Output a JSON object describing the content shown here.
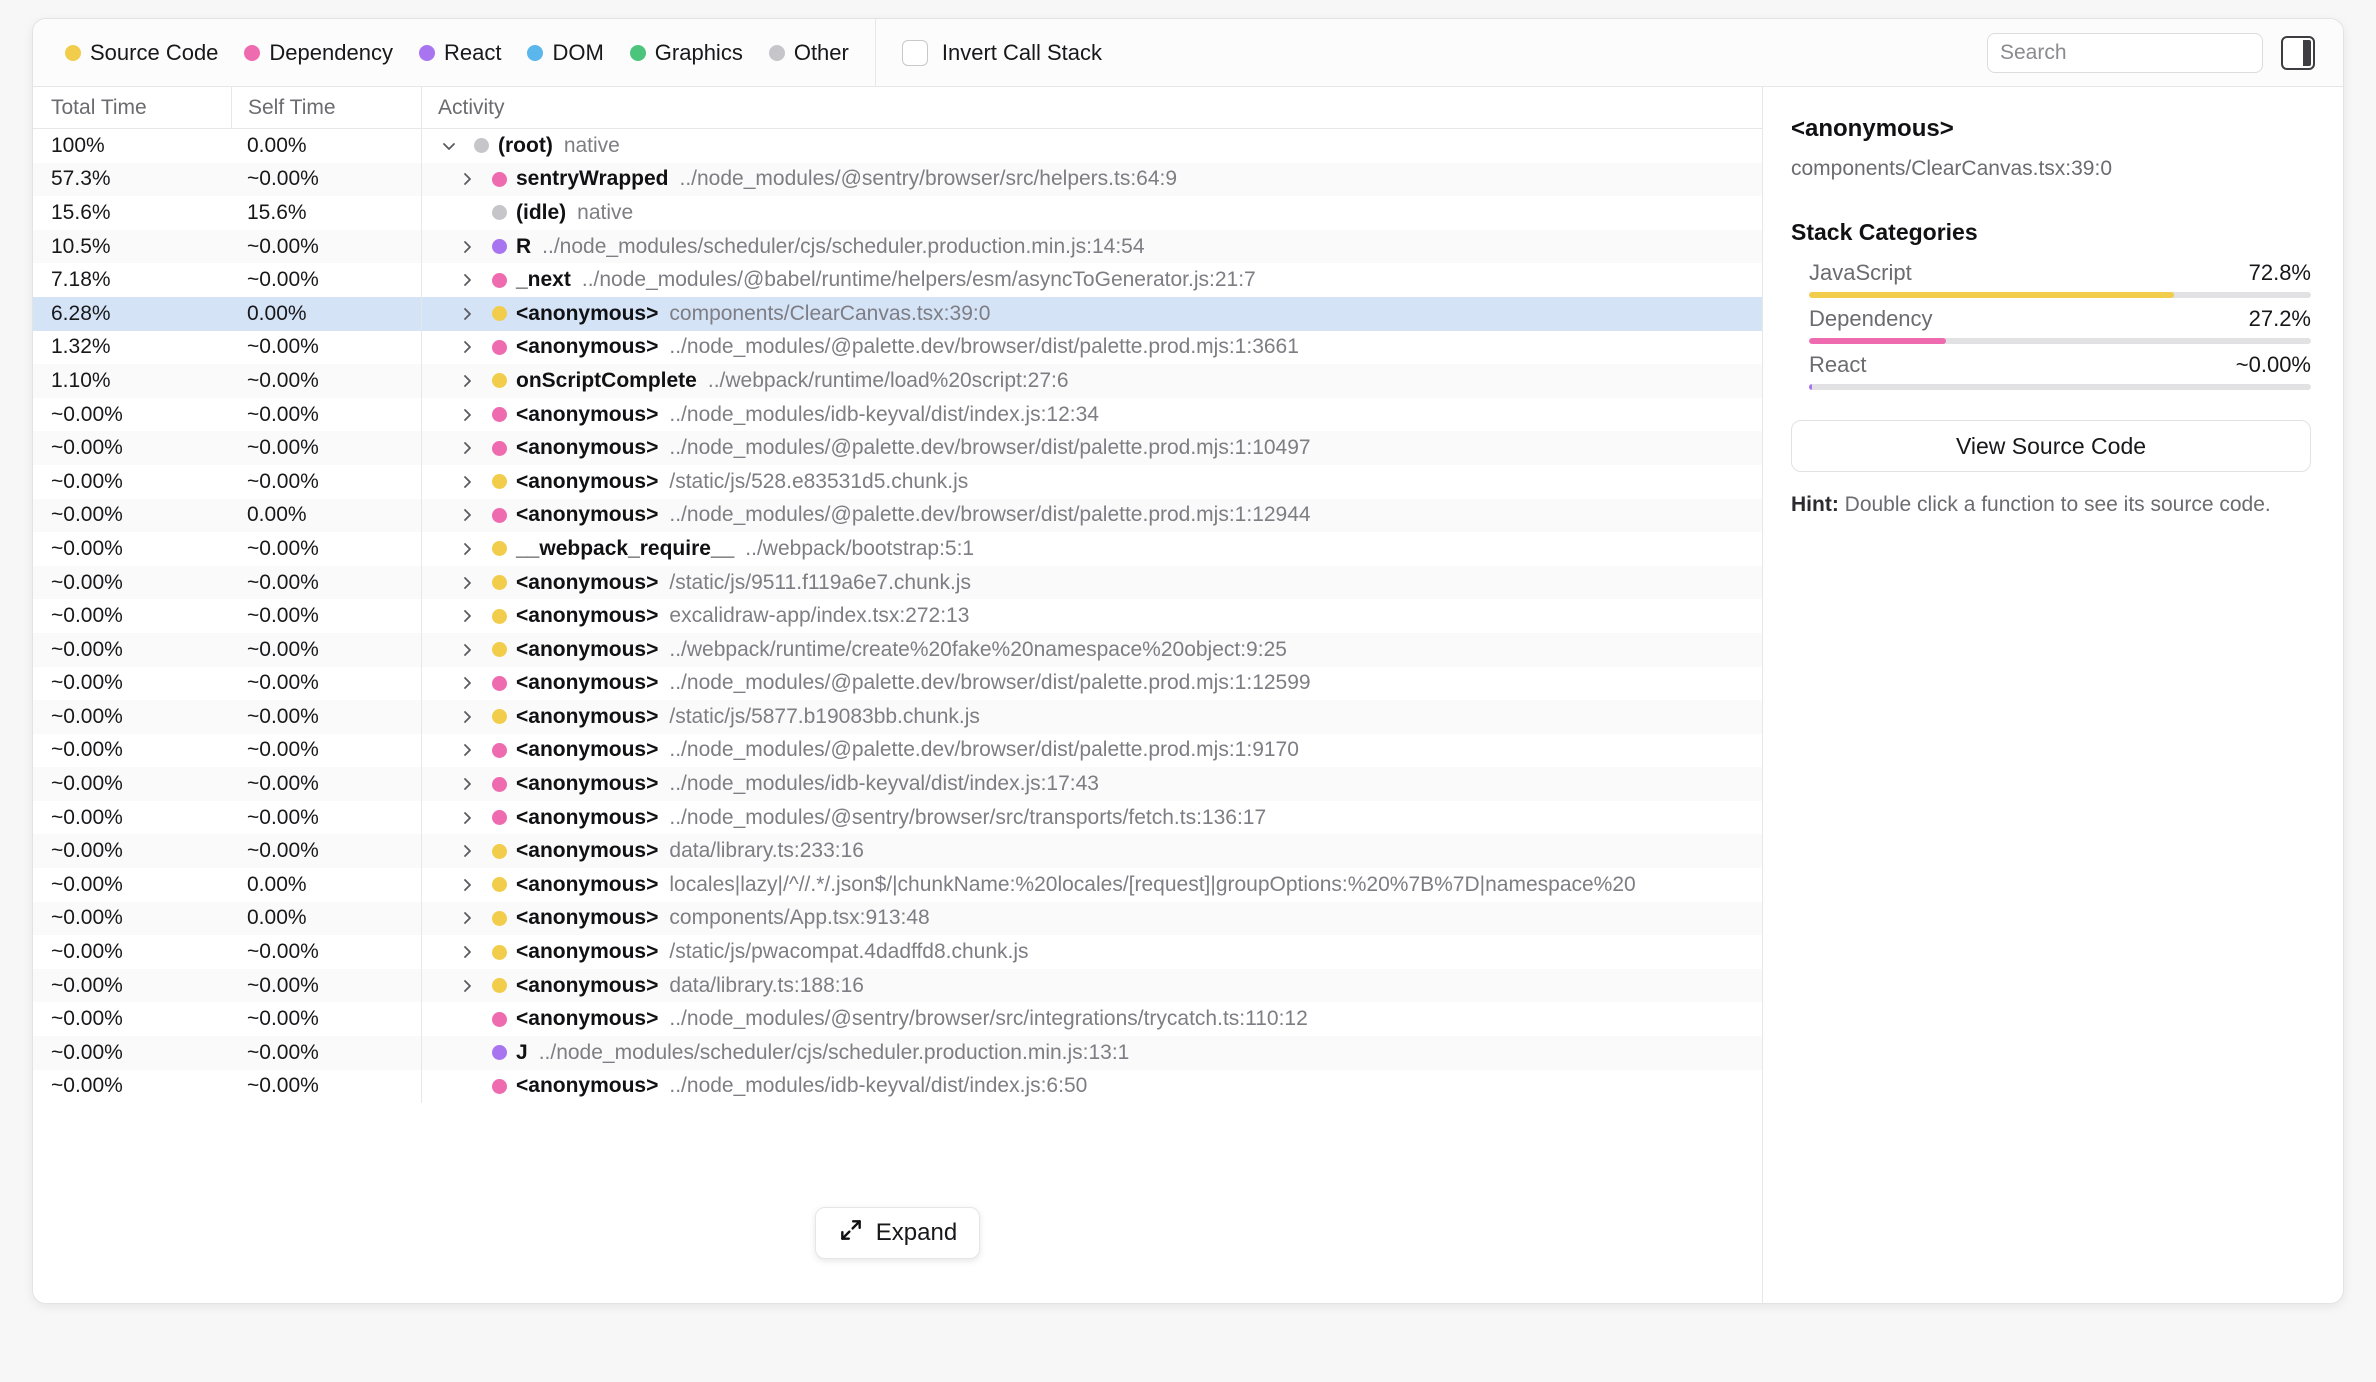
{
  "toolbar": {
    "legend": [
      {
        "label": "Source Code",
        "color": "#f2cd4b"
      },
      {
        "label": "Dependency",
        "color": "#ef6bb0"
      },
      {
        "label": "React",
        "color": "#a974f0"
      },
      {
        "label": "DOM",
        "color": "#5bb6ec"
      },
      {
        "label": "Graphics",
        "color": "#4cc47c"
      },
      {
        "label": "Other",
        "color": "#c6c6ca"
      }
    ],
    "invert_label": "Invert Call Stack",
    "invert_checked": false,
    "search_placeholder": "Search",
    "search_value": "",
    "panel_toggle_icon": "sidebar-toggle-icon"
  },
  "table": {
    "columns": [
      "Total Time",
      "Self Time",
      "Activity"
    ],
    "rows": [
      {
        "total": "100%",
        "self": "0.00%",
        "depth": 0,
        "twisty": "down",
        "color": "#c6c6ca",
        "name": "(root)",
        "loc": "native"
      },
      {
        "total": "57.3%",
        "self": "~0.00%",
        "depth": 1,
        "twisty": "right",
        "color": "#ef6bb0",
        "name": "sentryWrapped",
        "loc": "../node_modules/@sentry/browser/src/helpers.ts:64:9"
      },
      {
        "total": "15.6%",
        "self": "15.6%",
        "depth": 1,
        "twisty": "none",
        "color": "#c6c6ca",
        "name": "(idle)",
        "loc": "native"
      },
      {
        "total": "10.5%",
        "self": "~0.00%",
        "depth": 1,
        "twisty": "right",
        "color": "#a974f0",
        "name": "R",
        "loc": "../node_modules/scheduler/cjs/scheduler.production.min.js:14:54"
      },
      {
        "total": "7.18%",
        "self": "~0.00%",
        "depth": 1,
        "twisty": "right",
        "color": "#ef6bb0",
        "name": "_next",
        "loc": "../node_modules/@babel/runtime/helpers/esm/asyncToGenerator.js:21:7"
      },
      {
        "total": "6.28%",
        "self": "0.00%",
        "depth": 1,
        "twisty": "right",
        "color": "#f2cd4b",
        "name": "<anonymous>",
        "loc": "components/ClearCanvas.tsx:39:0",
        "selected": true
      },
      {
        "total": "1.32%",
        "self": "~0.00%",
        "depth": 1,
        "twisty": "right",
        "color": "#ef6bb0",
        "name": "<anonymous>",
        "loc": "../node_modules/@palette.dev/browser/dist/palette.prod.mjs:1:3661"
      },
      {
        "total": "1.10%",
        "self": "~0.00%",
        "depth": 1,
        "twisty": "right",
        "color": "#f2cd4b",
        "name": "onScriptComplete",
        "loc": "../webpack/runtime/load%20script:27:6"
      },
      {
        "total": "~0.00%",
        "self": "~0.00%",
        "depth": 1,
        "twisty": "right",
        "color": "#ef6bb0",
        "name": "<anonymous>",
        "loc": "../node_modules/idb-keyval/dist/index.js:12:34"
      },
      {
        "total": "~0.00%",
        "self": "~0.00%",
        "depth": 1,
        "twisty": "right",
        "color": "#ef6bb0",
        "name": "<anonymous>",
        "loc": "../node_modules/@palette.dev/browser/dist/palette.prod.mjs:1:10497"
      },
      {
        "total": "~0.00%",
        "self": "~0.00%",
        "depth": 1,
        "twisty": "right",
        "color": "#f2cd4b",
        "name": "<anonymous>",
        "loc": "/static/js/528.e83531d5.chunk.js"
      },
      {
        "total": "~0.00%",
        "self": "0.00%",
        "depth": 1,
        "twisty": "right",
        "color": "#ef6bb0",
        "name": "<anonymous>",
        "loc": "../node_modules/@palette.dev/browser/dist/palette.prod.mjs:1:12944"
      },
      {
        "total": "~0.00%",
        "self": "~0.00%",
        "depth": 1,
        "twisty": "right",
        "color": "#f2cd4b",
        "name": "__webpack_require__",
        "loc": "../webpack/bootstrap:5:1"
      },
      {
        "total": "~0.00%",
        "self": "~0.00%",
        "depth": 1,
        "twisty": "right",
        "color": "#f2cd4b",
        "name": "<anonymous>",
        "loc": "/static/js/9511.f119a6e7.chunk.js"
      },
      {
        "total": "~0.00%",
        "self": "~0.00%",
        "depth": 1,
        "twisty": "right",
        "color": "#f2cd4b",
        "name": "<anonymous>",
        "loc": "excalidraw-app/index.tsx:272:13"
      },
      {
        "total": "~0.00%",
        "self": "~0.00%",
        "depth": 1,
        "twisty": "right",
        "color": "#f2cd4b",
        "name": "<anonymous>",
        "loc": "../webpack/runtime/create%20fake%20namespace%20object:9:25"
      },
      {
        "total": "~0.00%",
        "self": "~0.00%",
        "depth": 1,
        "twisty": "right",
        "color": "#ef6bb0",
        "name": "<anonymous>",
        "loc": "../node_modules/@palette.dev/browser/dist/palette.prod.mjs:1:12599"
      },
      {
        "total": "~0.00%",
        "self": "~0.00%",
        "depth": 1,
        "twisty": "right",
        "color": "#f2cd4b",
        "name": "<anonymous>",
        "loc": "/static/js/5877.b19083bb.chunk.js"
      },
      {
        "total": "~0.00%",
        "self": "~0.00%",
        "depth": 1,
        "twisty": "right",
        "color": "#ef6bb0",
        "name": "<anonymous>",
        "loc": "../node_modules/@palette.dev/browser/dist/palette.prod.mjs:1:9170"
      },
      {
        "total": "~0.00%",
        "self": "~0.00%",
        "depth": 1,
        "twisty": "right",
        "color": "#ef6bb0",
        "name": "<anonymous>",
        "loc": "../node_modules/idb-keyval/dist/index.js:17:43"
      },
      {
        "total": "~0.00%",
        "self": "~0.00%",
        "depth": 1,
        "twisty": "right",
        "color": "#ef6bb0",
        "name": "<anonymous>",
        "loc": "../node_modules/@sentry/browser/src/transports/fetch.ts:136:17"
      },
      {
        "total": "~0.00%",
        "self": "~0.00%",
        "depth": 1,
        "twisty": "right",
        "color": "#f2cd4b",
        "name": "<anonymous>",
        "loc": "data/library.ts:233:16"
      },
      {
        "total": "~0.00%",
        "self": "0.00%",
        "depth": 1,
        "twisty": "right",
        "color": "#f2cd4b",
        "name": "<anonymous>",
        "loc": "locales|lazy|/^//.*/.json$/|chunkName:%20locales/[request]|groupOptions:%20%7B%7D|namespace%20"
      },
      {
        "total": "~0.00%",
        "self": "0.00%",
        "depth": 1,
        "twisty": "right",
        "color": "#f2cd4b",
        "name": "<anonymous>",
        "loc": "components/App.tsx:913:48"
      },
      {
        "total": "~0.00%",
        "self": "~0.00%",
        "depth": 1,
        "twisty": "right",
        "color": "#f2cd4b",
        "name": "<anonymous>",
        "loc": "/static/js/pwacompat.4dadffd8.chunk.js"
      },
      {
        "total": "~0.00%",
        "self": "~0.00%",
        "depth": 1,
        "twisty": "right",
        "color": "#f2cd4b",
        "name": "<anonymous>",
        "loc": "data/library.ts:188:16"
      },
      {
        "total": "~0.00%",
        "self": "~0.00%",
        "depth": 1,
        "twisty": "none",
        "color": "#ef6bb0",
        "name": "<anonymous>",
        "loc": "../node_modules/@sentry/browser/src/integrations/trycatch.ts:110:12"
      },
      {
        "total": "~0.00%",
        "self": "~0.00%",
        "depth": 1,
        "twisty": "none",
        "color": "#a974f0",
        "name": "J",
        "loc": "../node_modules/scheduler/cjs/scheduler.production.min.js:13:1"
      },
      {
        "total": "~0.00%",
        "self": "~0.00%",
        "depth": 1,
        "twisty": "none",
        "color": "#ef6bb0",
        "name": "<anonymous>",
        "loc": "../node_modules/idb-keyval/dist/index.js:6:50"
      }
    ],
    "expand_label": "Expand"
  },
  "sidebar": {
    "title": "<anonymous>",
    "subtitle": "components/ClearCanvas.tsx:39:0",
    "section_title": "Stack Categories",
    "categories": [
      {
        "name": "JavaScript",
        "value": "72.8%",
        "pct": 72.8,
        "color": "#f2cd4b"
      },
      {
        "name": "Dependency",
        "value": "27.2%",
        "pct": 27.2,
        "color": "#ef6bb0"
      },
      {
        "name": "React",
        "value": "~0.00%",
        "pct": 0.6,
        "color": "#a974f0"
      }
    ],
    "view_source_label": "View Source Code",
    "hint_prefix": "Hint:",
    "hint_text": " Double click a function to see its source code."
  }
}
